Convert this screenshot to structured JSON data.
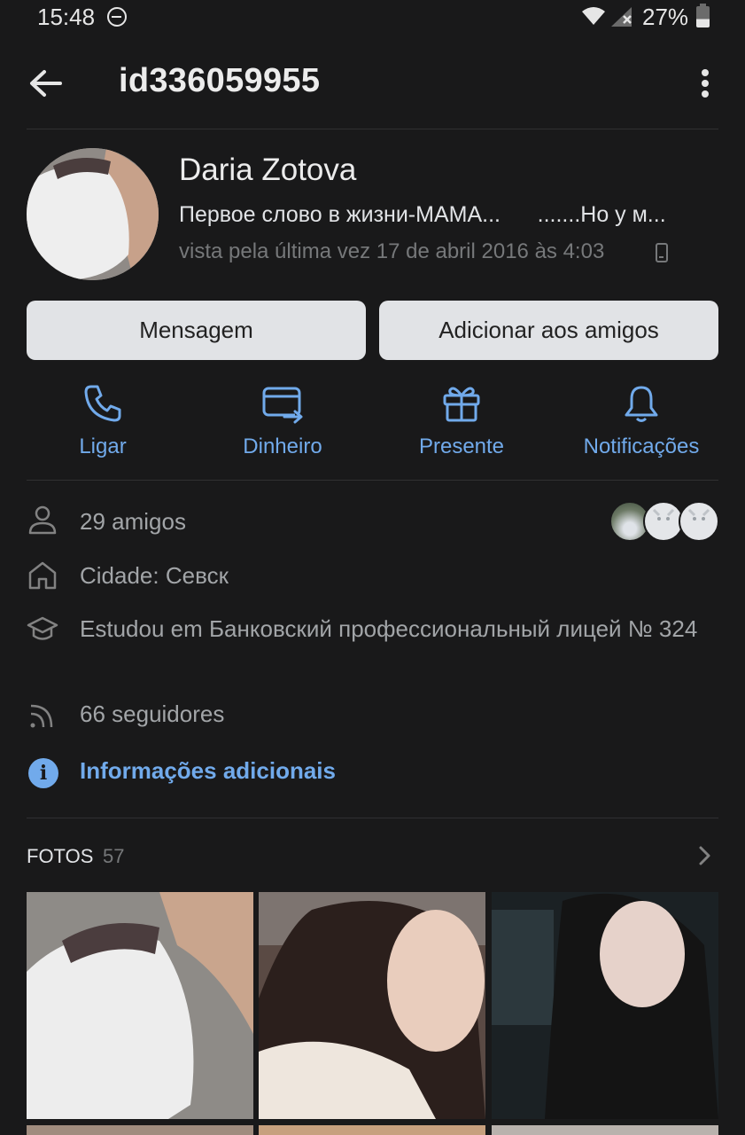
{
  "status_bar": {
    "time": "15:48",
    "battery": "27%",
    "icons": [
      "do-not-disturb-icon",
      "wifi-icon",
      "signal-icon",
      "battery-icon"
    ]
  },
  "header": {
    "title": "id336059955",
    "back_icon": "arrow-left-icon",
    "more_icon": "kebab-menu-icon"
  },
  "profile": {
    "name": "Daria Zotova",
    "status": "Первое слово в жизни-МАМА...      .......Но у м...",
    "last_seen": "vista pela última vez 17 de abril 2016 às 4:03",
    "device_icon": "mobile-phone-icon"
  },
  "buttons": {
    "message": "Mensagem",
    "add_friend": "Adicionar aos amigos"
  },
  "actions": [
    {
      "label": "Ligar",
      "icon": "phone-call-icon"
    },
    {
      "label": "Dinheiro",
      "icon": "money-transfer-icon"
    },
    {
      "label": "Presente",
      "icon": "gift-icon"
    },
    {
      "label": "Notificações",
      "icon": "bell-icon"
    }
  ],
  "info": {
    "friends": "29 amigos",
    "city": "Cidade: Севск",
    "education": "Estudou em Банковский профессиональный лицей № 324",
    "followers": "66 seguidores",
    "more_info": "Informações adicionais"
  },
  "photos": {
    "title": "FOTOS",
    "count": "57"
  },
  "colors": {
    "background": "#19191a",
    "accent": "#71aaeb",
    "button_bg": "#e1e3e6",
    "secondary_text": "#76787a"
  }
}
